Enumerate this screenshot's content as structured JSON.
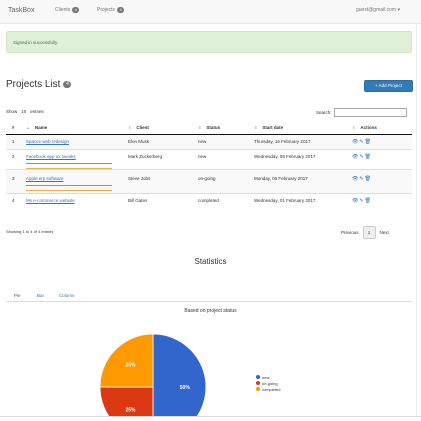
{
  "navbar": {
    "brand": "TaskBox",
    "clients_label": "Clients",
    "clients_count": "4",
    "projects_label": "Projects",
    "projects_count": "4",
    "user": "guest@gmail.com ▾"
  },
  "alert": {
    "text": "Signed in successfully."
  },
  "page": {
    "title": "Projects List",
    "count": "4",
    "add_button": "+ Add Project"
  },
  "table_controls": {
    "show_label": "Show",
    "entries_value": "10",
    "entries_label": "entries",
    "search_label": "Search:"
  },
  "table": {
    "headers": [
      "#",
      "Name",
      "Client",
      "Status",
      "Start date",
      "Actions"
    ],
    "rows": [
      {
        "num": "1",
        "name": "Spacex web redesign",
        "client": "Elon Musk",
        "status": "new",
        "start": "Thursday, 16 February 2017",
        "progress": null
      },
      {
        "num": "2",
        "name": "Facebook app ux tweaks",
        "client": "Mark Zuckerberg",
        "status": "new",
        "start": "Wednesday, 08 February 2017",
        "progress": "green/orange"
      },
      {
        "num": "3",
        "name": "Apple erp software",
        "client": "Steve Jobs",
        "status": "on-going",
        "start": "Monday, 06 February 2017",
        "progress": "green/orange"
      },
      {
        "num": "4",
        "name": "Ms e-commerce website",
        "client": "Bill Gates",
        "status": "completed",
        "start": "Wednesday, 01 February 2017",
        "progress": null
      }
    ],
    "action_icons": [
      "eye-icon",
      "pencil-icon",
      "trash-icon"
    ]
  },
  "pagination": {
    "info": "Showing 1 to 4 of 4 entries",
    "previous": "Previous",
    "current": "1",
    "next": "Next"
  },
  "statistics": {
    "title": "Statistics",
    "tabs": [
      "Pie",
      "Bar",
      "Column"
    ],
    "active_tab": "Pie"
  },
  "chart_data": {
    "type": "pie",
    "title": "Based on project status",
    "categories": [
      "new",
      "on-going",
      "completed"
    ],
    "values": [
      50,
      25,
      25
    ],
    "labels": [
      "50%",
      "25%",
      "25%"
    ],
    "colors": [
      "#3366cc",
      "#dc3912",
      "#ff9900"
    ],
    "legend": "right"
  }
}
